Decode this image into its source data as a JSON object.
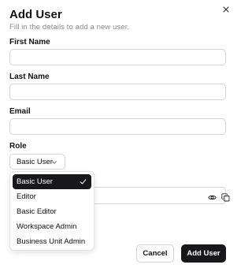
{
  "dialog": {
    "title": "Add User",
    "subtitle": "Fill in the details to add a new user."
  },
  "fields": {
    "first_name_label": "First Name",
    "first_name_value": "",
    "last_name_label": "Last Name",
    "last_name_value": "",
    "email_label": "Email",
    "email_value": ""
  },
  "role": {
    "label": "Role",
    "selected": "Basic User",
    "options": [
      "Basic User",
      "Editor",
      "Basic Editor",
      "Workspace Admin",
      "Business Unit Admin"
    ]
  },
  "icons": {
    "close": "close-icon",
    "chevron": "chevron-down-icon",
    "check": "check-icon",
    "eye": "eye-icon",
    "copy": "copy-icon"
  },
  "actions": {
    "cancel_label": "Cancel",
    "submit_label": "Add User"
  },
  "colors": {
    "primary": "#18181b",
    "border": "#d4d4d8",
    "muted_text": "#8a8a8a"
  }
}
